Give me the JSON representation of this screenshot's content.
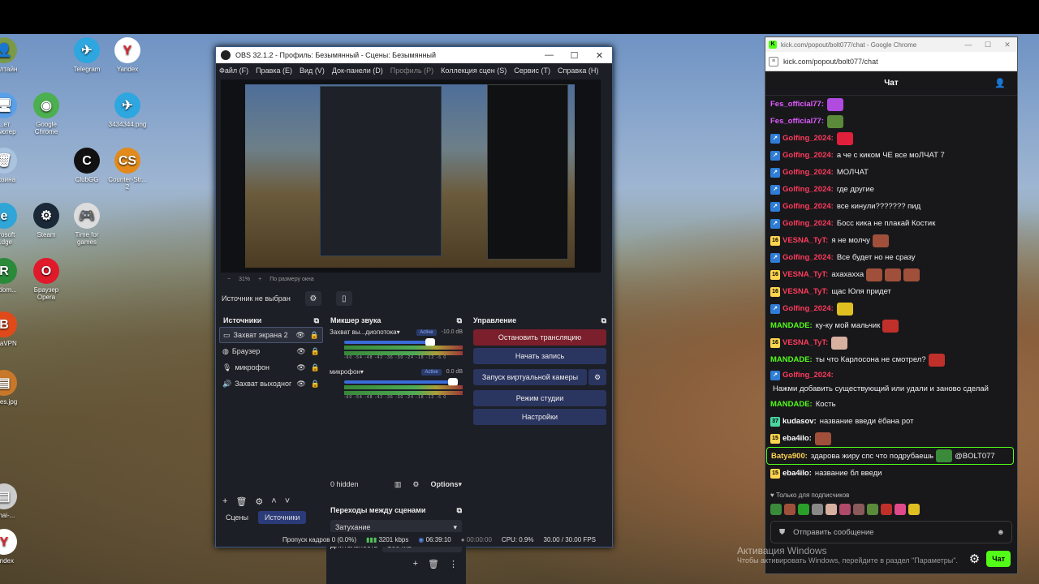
{
  "desktop": {
    "icons": [
      {
        "label": "...алтайн",
        "color": "#7a9a4a",
        "glyph": "👤"
      },
      {
        "label": "Telegram",
        "color": "#2ea6e0",
        "glyph": "✈"
      },
      {
        "label": "Yandex",
        "color": "#ffffff",
        "glyph": "Y"
      },
      {
        "label": "...ет\n...ьютер",
        "color": "#5aa0e8",
        "glyph": "🖥"
      },
      {
        "label": "Google\nChrome",
        "color": "#4caf50",
        "glyph": "◉"
      },
      {
        "label": "3434344.png",
        "color": "#2ea6e0",
        "glyph": "✈"
      },
      {
        "label": "...рзина",
        "color": "#aac4e0",
        "glyph": "🗑"
      },
      {
        "label": "ClubGG",
        "color": "#111111",
        "glyph": "C"
      },
      {
        "label": "Counter-Str...\n2",
        "color": "#e38a1a",
        "glyph": "CS"
      },
      {
        "label": "...rosoft\n...dge",
        "color": "#2fa5d8",
        "glyph": "e"
      },
      {
        "label": "Steam",
        "color": "#1b2838",
        "glyph": "⚙"
      },
      {
        "label": "Time for\ngames",
        "color": "#dddddd",
        "glyph": "🎮"
      },
      {
        "label": "...rdom...",
        "color": "#2a8a3a",
        "glyph": "R"
      },
      {
        "label": "Браузер\nOpera",
        "color": "#e01a2a",
        "glyph": "O"
      },
      {
        "label": "...yaVPN",
        "color": "#e04a1a",
        "glyph": "B"
      },
      {
        "label": "...ges.jpg",
        "color": "#c8782a",
        "glyph": "▤"
      },
      {
        "label": "...nai-...",
        "color": "#cccccc",
        "glyph": "▤"
      },
      {
        "label": "...ndex",
        "color": "#ffffff",
        "glyph": "Y"
      }
    ]
  },
  "obs": {
    "title": "OBS 32.1.2 - Профиль: Безымянный - Сцены: Безымянный",
    "window_controls": [
      "—",
      "☐",
      "✕"
    ],
    "menu": [
      "Файл (F)",
      "Правка (E)",
      "Вид (V)",
      "Док-панели (D)",
      "Профиль (P)",
      "Коллекция сцен (S)",
      "Сервис (T)",
      "Справка (H)"
    ],
    "zoom": {
      "minus": "−",
      "percent": "31%",
      "plus": "+",
      "fit": "По размеру окна"
    },
    "source_bar": {
      "label": "Источник не выбран"
    },
    "sources": {
      "title": "Источники",
      "items": [
        {
          "label": "Захват экрана 2",
          "icon": "monitor"
        },
        {
          "label": "Браузер",
          "icon": "globe"
        },
        {
          "label": "микрофон",
          "icon": "mic"
        },
        {
          "label": "Захват выходног",
          "icon": "speaker"
        }
      ]
    },
    "mixer": {
      "title": "Микшер звука",
      "channels": [
        {
          "name": "Захват вы...диопотока",
          "status": "Active",
          "db": "-10.0 dB",
          "volume": 0.8
        },
        {
          "name": "микрофон",
          "status": "Active",
          "db": "0.0 dB",
          "volume": 1.0
        }
      ],
      "ticks": "-60 -54 -48 -42 -36 -30 -24 -18 -12 -6 0",
      "hidden": "0 hidden",
      "options": "Options"
    },
    "transitions": {
      "title": "Переходы между сценами",
      "selected": "Затухание",
      "duration_label": "Длительность",
      "duration_value": "300 ms"
    },
    "controls": {
      "title": "Управление",
      "stop_stream": "Остановить трансляцию",
      "start_record": "Начать запись",
      "virtual_cam": "Запуск виртуальной камеры",
      "studio": "Режим студии",
      "settings": "Настройки"
    },
    "tabs": {
      "scenes": "Сцены",
      "sources": "Источники"
    },
    "status": {
      "dropped": "Пропуск кадров 0 (0.0%)",
      "bitrate": "3201 kbps",
      "live_time": "06:39:10",
      "rec_time": "00:00:00",
      "cpu": "CPU: 0.9%",
      "fps": "30.00 / 30.00 FPS"
    }
  },
  "chrome": {
    "title": "kick.com/popout/bolt077/chat - Google Chrome",
    "url": "kick.com/popout/bolt077/chat",
    "header": "Чат",
    "messages": [
      {
        "badge": "",
        "user": "Fes_official77:",
        "color": "#e05aff",
        "text": "",
        "emotes": [
          "#b04ae0"
        ]
      },
      {
        "badge": "",
        "user": "Fes_official77:",
        "color": "#e05aff",
        "text": "",
        "emotes": [
          "#5a8a3a"
        ]
      },
      {
        "badge": "prime",
        "user": "Golfing_2024:",
        "color": "#ff3b5c",
        "text": "",
        "emotes": [
          "#e0203a"
        ]
      },
      {
        "badge": "prime",
        "user": "Golfing_2024:",
        "color": "#ff3b5c",
        "text": "а че с киком ЧЕ все моЛЧАТ 7",
        "emotes": []
      },
      {
        "badge": "prime",
        "user": "Golfing_2024:",
        "color": "#ff3b5c",
        "text": "МОЛЧАТ",
        "emotes": []
      },
      {
        "badge": "prime",
        "user": "Golfing_2024:",
        "color": "#ff3b5c",
        "text": "где другие",
        "emotes": []
      },
      {
        "badge": "prime",
        "user": "Golfing_2024:",
        "color": "#ff3b5c",
        "text": "все кинули??????? пид",
        "emotes": []
      },
      {
        "badge": "prime",
        "user": "Golfing_2024:",
        "color": "#ff3b5c",
        "text": "Босс кика не плакай Костик",
        "emotes": []
      },
      {
        "badge": "16",
        "user": "VESNA_TyT:",
        "color": "#ff3b5c",
        "text": "я не молчу",
        "emotes": [
          "#a0503a"
        ]
      },
      {
        "badge": "prime",
        "user": "Golfing_2024:",
        "color": "#ff3b5c",
        "text": "Все будет но не сразу",
        "emotes": []
      },
      {
        "badge": "16",
        "user": "VESNA_TyT:",
        "color": "#ff3b5c",
        "text": "ахахахха",
        "emotes": [
          "#a0503a",
          "#a0503a",
          "#a0503a"
        ]
      },
      {
        "badge": "16",
        "user": "VESNA_TyT:",
        "color": "#ff3b5c",
        "text": "щас Юля придет",
        "emotes": []
      },
      {
        "badge": "prime",
        "user": "Golfing_2024:",
        "color": "#ff3b5c",
        "text": "",
        "emotes": [
          "#e0c020"
        ]
      },
      {
        "badge": "",
        "user": "MANDADE:",
        "color": "#53fc18",
        "text": "ку-ку мой мальчик",
        "emotes": [
          "#c0302a"
        ]
      },
      {
        "badge": "16",
        "user": "VESNA_TyT:",
        "color": "#ff3b5c",
        "text": "",
        "emotes": [
          "#d8b0a0"
        ]
      },
      {
        "badge": "",
        "user": "MANDADE:",
        "color": "#53fc18",
        "text": "ты что Карлосона не смотрел?",
        "emotes": [
          "#c0302a"
        ]
      },
      {
        "badge": "prime",
        "user": "Golfing_2024:",
        "color": "#ff3b5c",
        "text": "Нажми добавить существующий или удали и заново сделай",
        "emotes": []
      },
      {
        "badge": "",
        "user": "MANDADE:",
        "color": "#53fc18",
        "text": "Кость",
        "emotes": []
      },
      {
        "badge": "37",
        "user": "kudasov:",
        "color": "#ffffff",
        "text": "название введи ёбана рот",
        "emotes": []
      },
      {
        "badge": "15",
        "user": "eba4ilo:",
        "color": "#ffffff",
        "text": "",
        "emotes": [
          "#a0503a"
        ]
      },
      {
        "badge": "",
        "user": "Batya900:",
        "color": "#ffd54f",
        "text": "здарова жиру спс что подрубаешь",
        "emotes": [
          "#3a8a3a"
        ],
        "mention": "@BOLT077"
      },
      {
        "badge": "15",
        "user": "eba4ilo:",
        "color": "#ffffff",
        "text": "название бл введи",
        "emotes": []
      }
    ],
    "subscribers_only": "Только для подписчиков",
    "emote_bar": [
      "#3a8a3a",
      "#a0503a",
      "#2aa02a",
      "#888888",
      "#d8b0a0",
      "#b04a6a",
      "#8a5a5a",
      "#5a8a3a",
      "#c0302a",
      "#e04a8a",
      "#e0c020"
    ],
    "input_placeholder": "Отправить сообщение",
    "send_label": "Чат"
  },
  "watermark": {
    "title": "Активация Windows",
    "subtitle": "Чтобы активировать Windows, перейдите в раздел \"Параметры\"."
  }
}
